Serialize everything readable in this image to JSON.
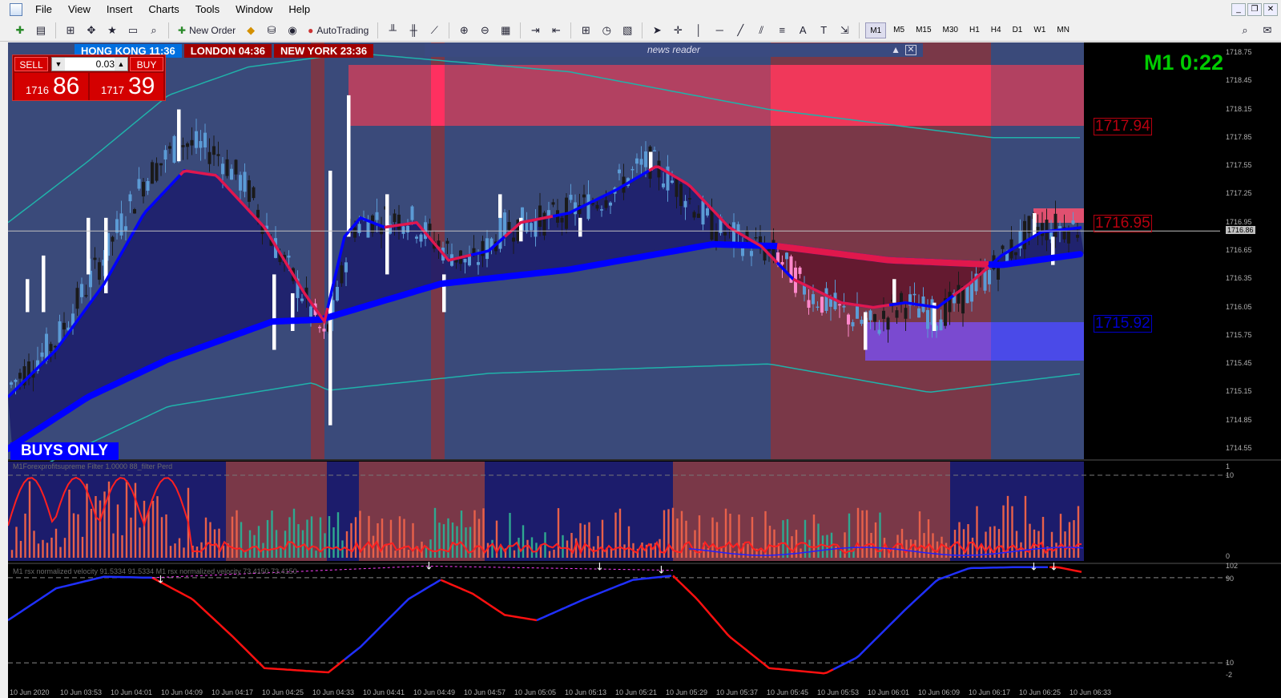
{
  "menu": {
    "items": [
      "File",
      "View",
      "Insert",
      "Charts",
      "Tools",
      "Window",
      "Help"
    ]
  },
  "toolbar": {
    "new_order": "New Order",
    "autotrading": "AutoTrading",
    "timeframes": [
      "M1",
      "M5",
      "M15",
      "M30",
      "H1",
      "H4",
      "D1",
      "W1",
      "MN"
    ]
  },
  "sessions": [
    {
      "label": "HONG KONG 11:36",
      "color": "#0070e0"
    },
    {
      "label": "LONDON  04:36",
      "color": "#a00000"
    },
    {
      "label": "NEW YORK  23:36",
      "color": "#a00000"
    }
  ],
  "news_reader": {
    "title": "news reader",
    "minimize": "▲",
    "close": "✕"
  },
  "trade_panel": {
    "sell_label": "SELL",
    "buy_label": "BUY",
    "lot": "0.03",
    "sell_small": "1716",
    "sell_big": "86",
    "buy_small": "1717",
    "buy_big": "39"
  },
  "status": {
    "buys_only": "BUYS ONLY",
    "timer": "M1 0:22"
  },
  "levels": {
    "upper": "1717.94",
    "middle": "1716.95",
    "lower": "1715.92"
  },
  "price_axis": {
    "labels": [
      "1718.75",
      "1718.45",
      "1718.15",
      "1717.85",
      "1717.55",
      "1717.25",
      "1716.95",
      "1716.86",
      "1716.65",
      "1716.35",
      "1716.05",
      "1715.75",
      "1715.45",
      "1715.15",
      "1714.85",
      "1714.55"
    ],
    "current": "1716.86"
  },
  "indicator1": {
    "title": "M1Forexprofitsupreme Filter 1.0000  88_filter  Perd",
    "axis": [
      "1",
      "10",
      "0"
    ]
  },
  "indicator2": {
    "title": "M1 rsx normalized velocity 91.5334 91.5334  M1 rsx normalized velocity 73.4150 73.4150",
    "axis": [
      "102",
      "90",
      "10",
      "-2"
    ]
  },
  "time_axis": [
    "10 Jun 2020",
    "10 Jun 03:53",
    "10 Jun 04:01",
    "10 Jun 04:09",
    "10 Jun 04:17",
    "10 Jun 04:25",
    "10 Jun 04:33",
    "10 Jun 04:41",
    "10 Jun 04:49",
    "10 Jun 04:57",
    "10 Jun 05:05",
    "10 Jun 05:13",
    "10 Jun 05:21",
    "10 Jun 05:29",
    "10 Jun 05:37",
    "10 Jun 05:45",
    "10 Jun 05:53",
    "10 Jun 06:01",
    "10 Jun 06:09",
    "10 Jun 06:17",
    "10 Jun 06:25",
    "10 Jun 06:33"
  ],
  "colors": {
    "bull_candle": "#5b9bd5",
    "bear_candle": "#1a1a1a",
    "bear_zone_candle": "#ff88cc",
    "fast_ma": "#e0184c",
    "slow_ma": "#0000ff",
    "band": "#20b2aa",
    "buy_zone_bg": "#1c1c6c",
    "sell_zone_bg": "#7a3848"
  }
}
